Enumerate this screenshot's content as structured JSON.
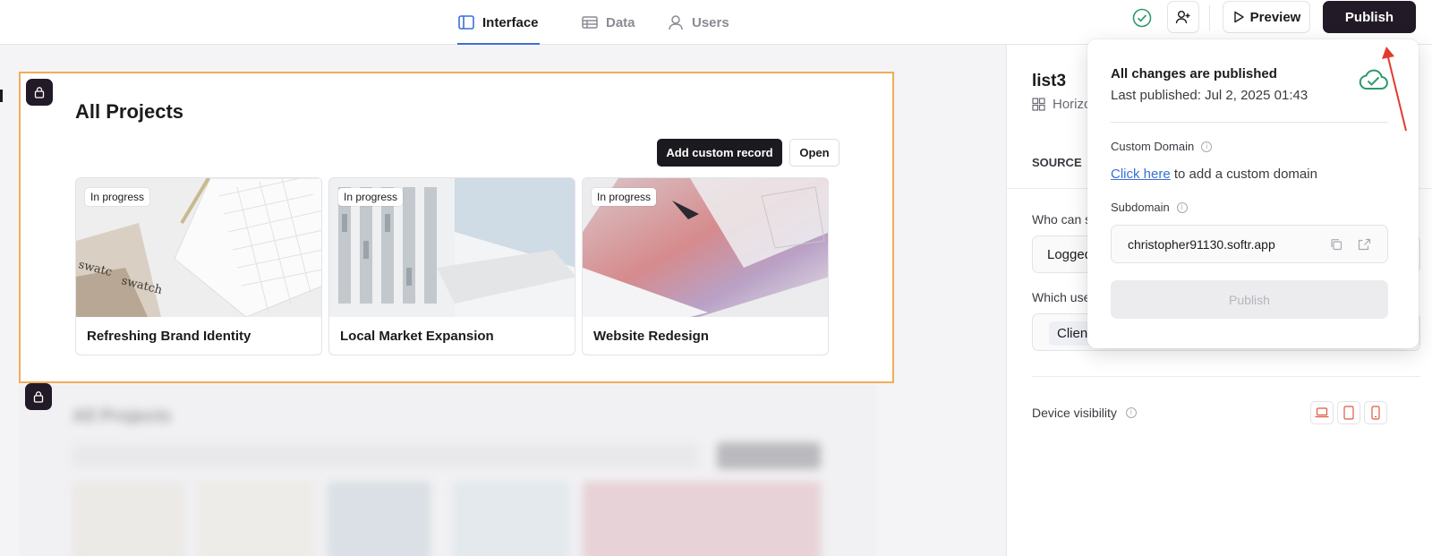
{
  "topbar": {
    "tabs": [
      {
        "label": "Interface",
        "icon": "layout-icon",
        "active": true
      },
      {
        "label": "Data",
        "icon": "table-icon",
        "active": false
      },
      {
        "label": "Users",
        "icon": "user-icon",
        "active": false
      }
    ],
    "preview_label": "Preview",
    "publish_label": "Publish"
  },
  "canvas": {
    "block_title": "All Projects",
    "add_record_label": "Add custom record",
    "open_label": "Open",
    "cards": [
      {
        "badge": "In progress",
        "title": "Refreshing Brand Identity",
        "image": "keyboard-swatch-image"
      },
      {
        "badge": "In progress",
        "title": "Local Market Expansion",
        "image": "building-image"
      },
      {
        "badge": "In progress",
        "title": "Website Redesign",
        "image": "laptop-image"
      }
    ],
    "ghost_block_title": "All Projects"
  },
  "right_panel": {
    "title": "list3",
    "layout_label": "Horizo",
    "source_label": "SOURCE",
    "who_can_see_label": "Who can s",
    "who_can_see_value": "Logged",
    "which_users_label": "Which use",
    "which_users_value": "Client",
    "device_visibility_label": "Device visibility"
  },
  "popover": {
    "heading": "All changes are published",
    "last_published": "Last published: Jul 2, 2025 01:43",
    "custom_domain_label": "Custom Domain",
    "custom_domain_link": "Click here",
    "custom_domain_rest": " to add a custom domain",
    "subdomain_label": "Subdomain",
    "subdomain_value": "christopher91130.softr.app",
    "publish_label": "Publish"
  },
  "colors": {
    "accent": "#3a6fd8",
    "dark": "#221a26",
    "selection": "#efad58",
    "success": "#2e9a6c",
    "device_icon": "#e0573f",
    "arrow": "#e23b2e"
  }
}
